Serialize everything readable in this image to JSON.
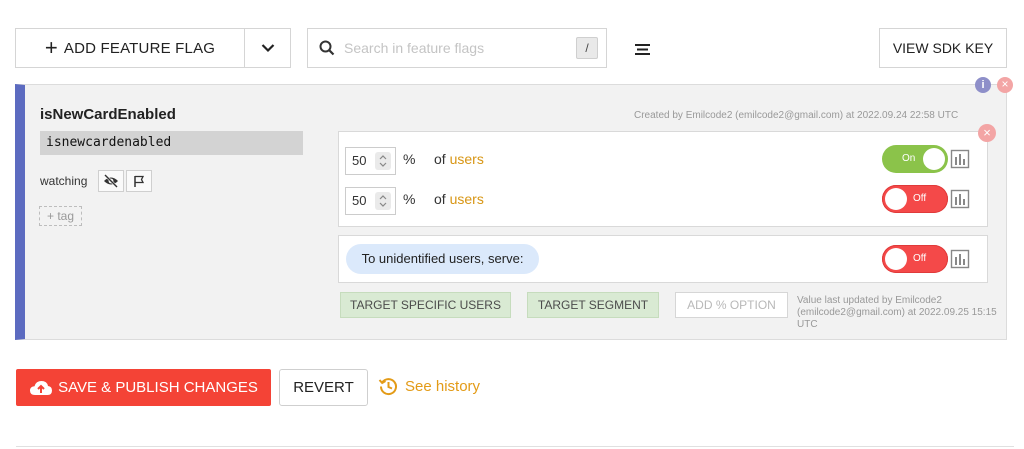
{
  "toolbar": {
    "add_label": "ADD FEATURE FLAG",
    "search_placeholder": "Search in feature flags",
    "search_shortcut": "/",
    "sdk_label": "VIEW SDK KEY"
  },
  "flag": {
    "name": "isNewCardEnabled",
    "key": "isnewcardenabled",
    "watching_label": "watching",
    "add_tag_label": "+ tag",
    "created_text": "Created by Emilcode2 (emilcode2@gmail.com) at 2022.09.24 22:58 UTC",
    "rules": [
      {
        "percent": "50",
        "pct_symbol": "%",
        "of_label": "of",
        "users_label": "users",
        "toggle_label": "On",
        "toggle_state": "on"
      },
      {
        "percent": "50",
        "pct_symbol": "%",
        "of_label": "of",
        "users_label": "users",
        "toggle_label": "Off",
        "toggle_state": "off"
      }
    ],
    "unidentified_label": "To unidentified users, serve:",
    "unidentified_toggle_label": "Off",
    "target_users_label": "TARGET SPECIFIC USERS",
    "target_segment_label": "TARGET SEGMENT",
    "add_pct_option_label": "ADD % OPTION",
    "last_updated_text": "Value last updated by Emilcode2 (emilcode2@gmail.com) at 2022.09.25 15:15 UTC"
  },
  "actions": {
    "save_label": "SAVE & PUBLISH CHANGES",
    "revert_label": "REVERT",
    "history_label": "See history"
  },
  "colors": {
    "accent_bar": "#5c6bc0",
    "toggle_on": "#8bc34a",
    "toggle_off": "#f44949",
    "save_button": "#f44336",
    "link_orange": "#e39b17"
  }
}
